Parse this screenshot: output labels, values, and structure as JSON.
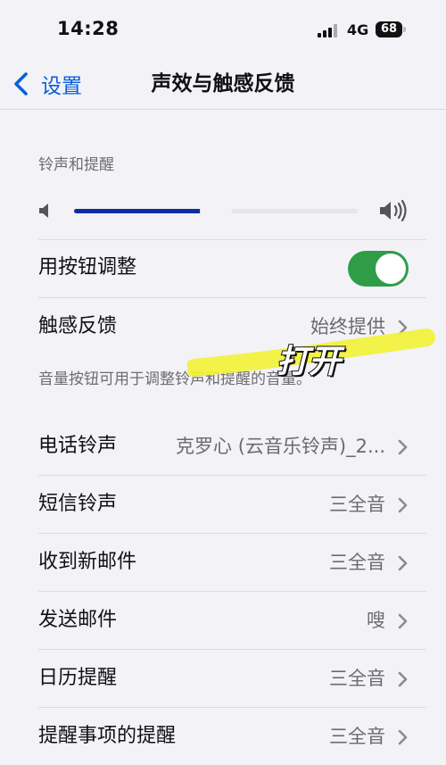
{
  "status_bar": {
    "time": "14:28",
    "network": "4G",
    "battery": "68"
  },
  "nav": {
    "back_label": "设置",
    "title": "声效与触感反馈"
  },
  "ringer": {
    "section_header": "铃声和提醒",
    "volume_fraction": 0.5,
    "use_buttons_label": "用按钮调整",
    "use_buttons_on": true,
    "haptics_label": "触感反馈",
    "haptics_value": "始终提供",
    "footer": "音量按钮可用于调整铃声和提醒的音量。"
  },
  "annotation": {
    "text": "打开"
  },
  "sounds": [
    {
      "label": "电话铃声",
      "value": "克罗心 (云音乐铃声)_2..."
    },
    {
      "label": "短信铃声",
      "value": "三全音"
    },
    {
      "label": "收到新邮件",
      "value": "三全音"
    },
    {
      "label": "发送邮件",
      "value": "嗖"
    },
    {
      "label": "日历提醒",
      "value": "三全音"
    },
    {
      "label": "提醒事项的提醒",
      "value": "三全音"
    }
  ],
  "colors": {
    "accent": "#0a5fd8",
    "toggle_on": "#2f9d48",
    "slider_fill": "#0d2f9e",
    "highlight": "#f2f238"
  }
}
